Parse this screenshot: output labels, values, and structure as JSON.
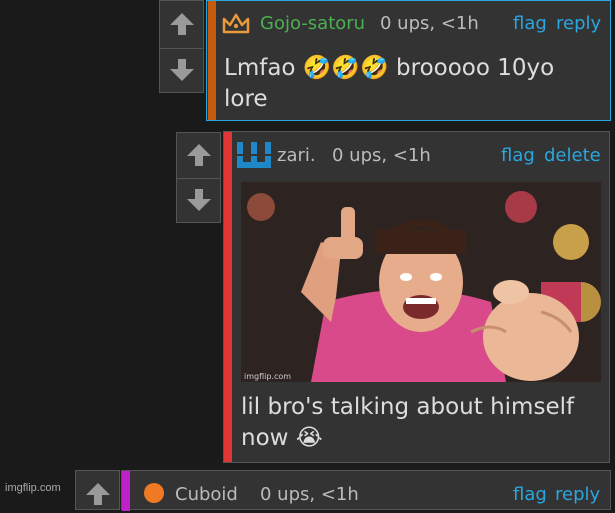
{
  "colors": {
    "background": "#1a1a1a",
    "panel": "#333333",
    "link": "#2ba6de",
    "username_green": "#4caf50",
    "bar_orange": "#c85a0e",
    "bar_red": "#e23636",
    "bar_magenta": "#c020c8",
    "cuboid_orange": "#f07a24"
  },
  "comments": [
    {
      "username": "Gojo-satoru",
      "badge_icon": "crown-icon",
      "meta": "0 ups, <1h",
      "actions": [
        "flag",
        "reply"
      ],
      "text": "Lmfao 🤣🤣🤣 brooooo 10yo\nlore"
    },
    {
      "username": "zari.",
      "badge_icon": "trident-icon",
      "meta": "0 ups, <1h",
      "actions": [
        "flag",
        "delete"
      ],
      "image_caption": "imgflip.com",
      "text": "lil bro's talking about himself\nnow 😭"
    },
    {
      "username": "Cuboid",
      "badge_icon": "orange-dot-icon",
      "meta": "0 ups, <1h",
      "actions": [
        "flag",
        "reply"
      ]
    }
  ],
  "watermark": "imgflip.com"
}
